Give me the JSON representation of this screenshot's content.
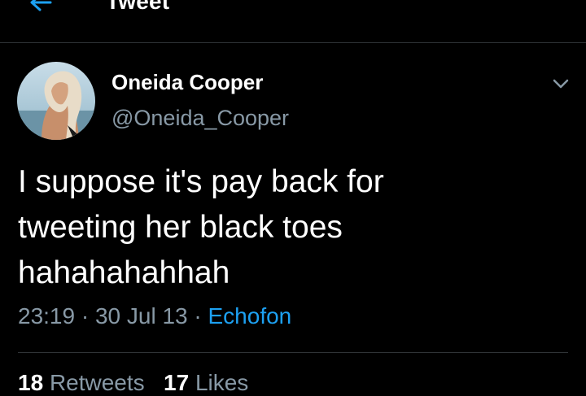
{
  "header": {
    "title": "Tweet",
    "back_icon": "arrow-left-icon"
  },
  "colors": {
    "background": "#000000",
    "accent": "#1da1f2",
    "secondary_text": "#8899a6",
    "divider": "#2f3336"
  },
  "tweet": {
    "author": {
      "name": "Oneida Cooper",
      "handle": "@Oneida_Cooper"
    },
    "text_lines": [
      "I suppose it's pay back for",
      "tweeting her black toes",
      "hahahahahhah"
    ],
    "time": "23:19",
    "sep1": " · ",
    "date": "30 Jul 13",
    "sep2": " · ",
    "source": "Echofon",
    "menu_icon": "chevron-down-icon"
  },
  "stats": {
    "retweets_count": "18",
    "retweets_label": "Retweets",
    "likes_count": "17",
    "likes_label": "Likes"
  }
}
